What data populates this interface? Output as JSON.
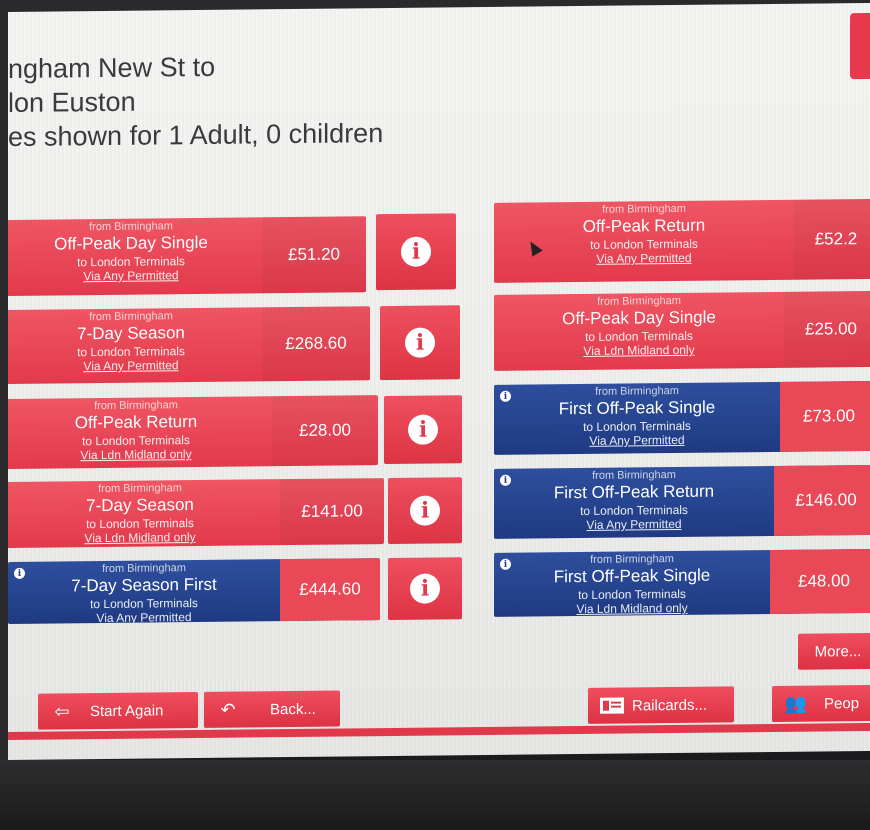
{
  "header": {
    "line1": "ngham New St to",
    "line2": "lon Euston",
    "line3": "es shown for 1 Adult, 0 children"
  },
  "tickets": [
    {
      "from": "from Birmingham",
      "name": "Off-Peak Day Single",
      "to": "to London Terminals",
      "via": "Via Any Permitted",
      "price": "£51.20"
    },
    {
      "from": "from Birmingham",
      "name": "7-Day Season",
      "to": "to London Terminals",
      "via": "Via Any Permitted",
      "price": "£268.60"
    },
    {
      "from": "from Birmingham",
      "name": "Off-Peak Return",
      "to": "to London Terminals",
      "via": "Via Ldn Midland only",
      "price": "£28.00"
    },
    {
      "from": "from Birmingham",
      "name": "7-Day Season",
      "to": "to London Terminals",
      "via": "Via Ldn Midland only",
      "price": "£141.00"
    },
    {
      "from": "from Birmingham",
      "name": "7-Day Season First",
      "to": "to London Terminals",
      "via": "Via Any Permitted",
      "price": "£444.60"
    },
    {
      "from": "from Birmingham",
      "name": "Off-Peak Return",
      "to": "to London Terminals",
      "via": "Via Any Permitted",
      "price": "£52.2"
    },
    {
      "from": "from Birmingham",
      "name": "Off-Peak Day Single",
      "to": "to London Terminals",
      "via": "Via Ldn Midland only",
      "price": "£25.00"
    },
    {
      "from": "from Birmingham",
      "name": "First Off-Peak Single",
      "to": "to London Terminals",
      "via": "Via Any Permitted",
      "price": "£73.00"
    },
    {
      "from": "from Birmingham",
      "name": "First Off-Peak Return",
      "to": "to London Terminals",
      "via": "Via Any Permitted",
      "price": "£146.00"
    },
    {
      "from": "from Birmingham",
      "name": "First Off-Peak Single",
      "to": "to London Terminals",
      "via": "Via Ldn Midland only",
      "price": "£48.00"
    }
  ],
  "buttons": {
    "more": "More...",
    "start_again": "Start Again",
    "back": "Back...",
    "railcards": "Railcards...",
    "people": "Peop"
  },
  "colors": {
    "accent_red": "#e23a4c",
    "first_class_blue": "#1f3a82"
  }
}
